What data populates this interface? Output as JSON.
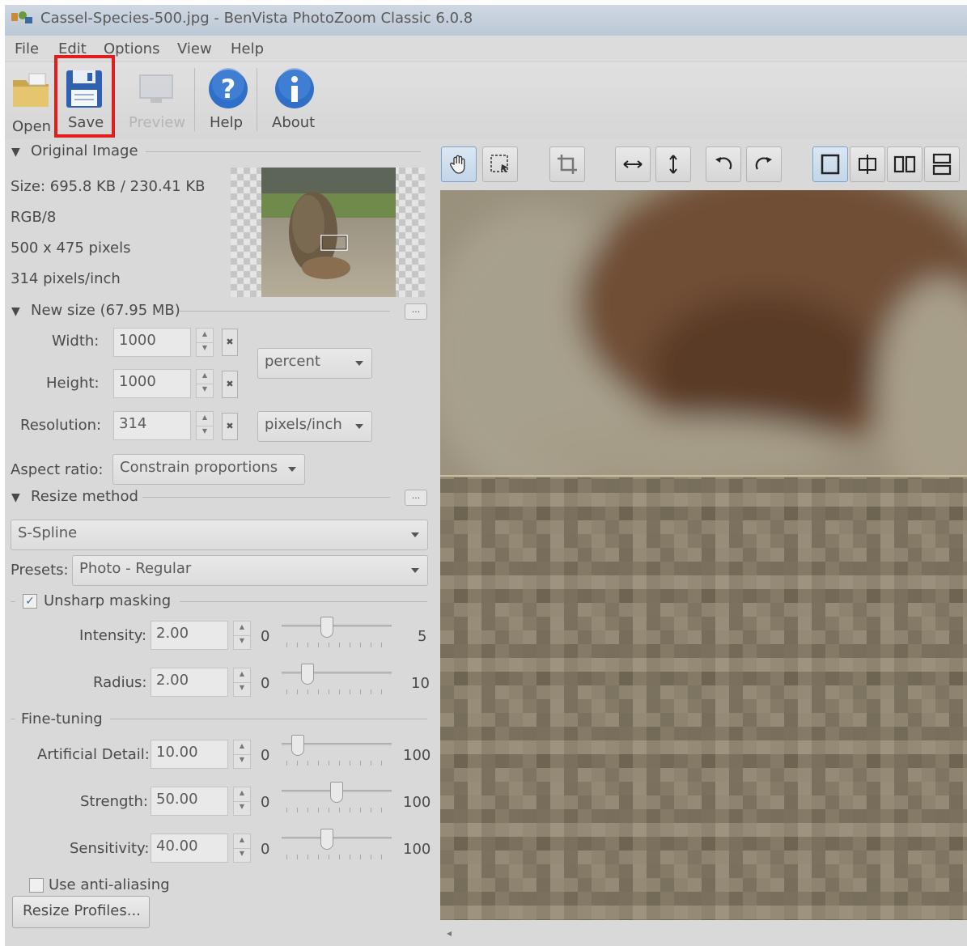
{
  "window": {
    "title": "Cassel-Species-500.jpg - BenVista PhotoZoom Classic 6.0.8"
  },
  "menu": [
    "File",
    "Edit",
    "Options",
    "View",
    "Help"
  ],
  "toolbar": {
    "open": "Open",
    "save": "Save",
    "preview": "Preview",
    "help": "Help",
    "about": "About"
  },
  "original_image": {
    "heading": "Original Image",
    "size": "Size: 695.8 KB / 230.41 KB",
    "mode": "RGB/8",
    "dimensions": "500 x 475 pixels",
    "resolution": "314 pixels/inch"
  },
  "new_size": {
    "heading": "New size (67.95 MB)",
    "dots": "...",
    "width_label": "Width:",
    "width_value": "1000",
    "height_label": "Height:",
    "height_value": "1000",
    "resolution_label": "Resolution:",
    "resolution_value": "314",
    "unit": "percent",
    "res_unit": "pixels/inch",
    "aspect_label": "Aspect ratio:",
    "aspect_value": "Constrain proportions"
  },
  "resize_method": {
    "heading": "Resize method",
    "dots": "...",
    "method": "S-Spline",
    "presets_label": "Presets:",
    "preset": "Photo - Regular"
  },
  "unsharp": {
    "heading": "Unsharp masking",
    "checked": true,
    "intensity_label": "Intensity:",
    "intensity_value": "2.00",
    "intensity_min": "0",
    "intensity_max": "5",
    "intensity_level": 0.4,
    "radius_label": "Radius:",
    "radius_value": "2.00",
    "radius_min": "0",
    "radius_max": "10",
    "radius_level": 0.2
  },
  "fine_tuning": {
    "heading": "Fine-tuning",
    "detail_label": "Artificial Detail:",
    "detail_value": "10.00",
    "detail_min": "0",
    "detail_max": "100",
    "detail_level": 0.1,
    "strength_label": "Strength:",
    "strength_value": "50.00",
    "strength_min": "0",
    "strength_max": "100",
    "strength_level": 0.5,
    "sensitivity_label": "Sensitivity:",
    "sensitivity_value": "40.00",
    "sensitivity_min": "0",
    "sensitivity_max": "100",
    "sensitivity_level": 0.4
  },
  "anti_aliasing": {
    "label": "Use anti-aliasing",
    "checked": false
  },
  "resize_profiles": "Resize Profiles...",
  "colors": {
    "highlight": "#e11d1d",
    "help_blue": "#2f6fc7",
    "save_blue": "#3060b0"
  }
}
